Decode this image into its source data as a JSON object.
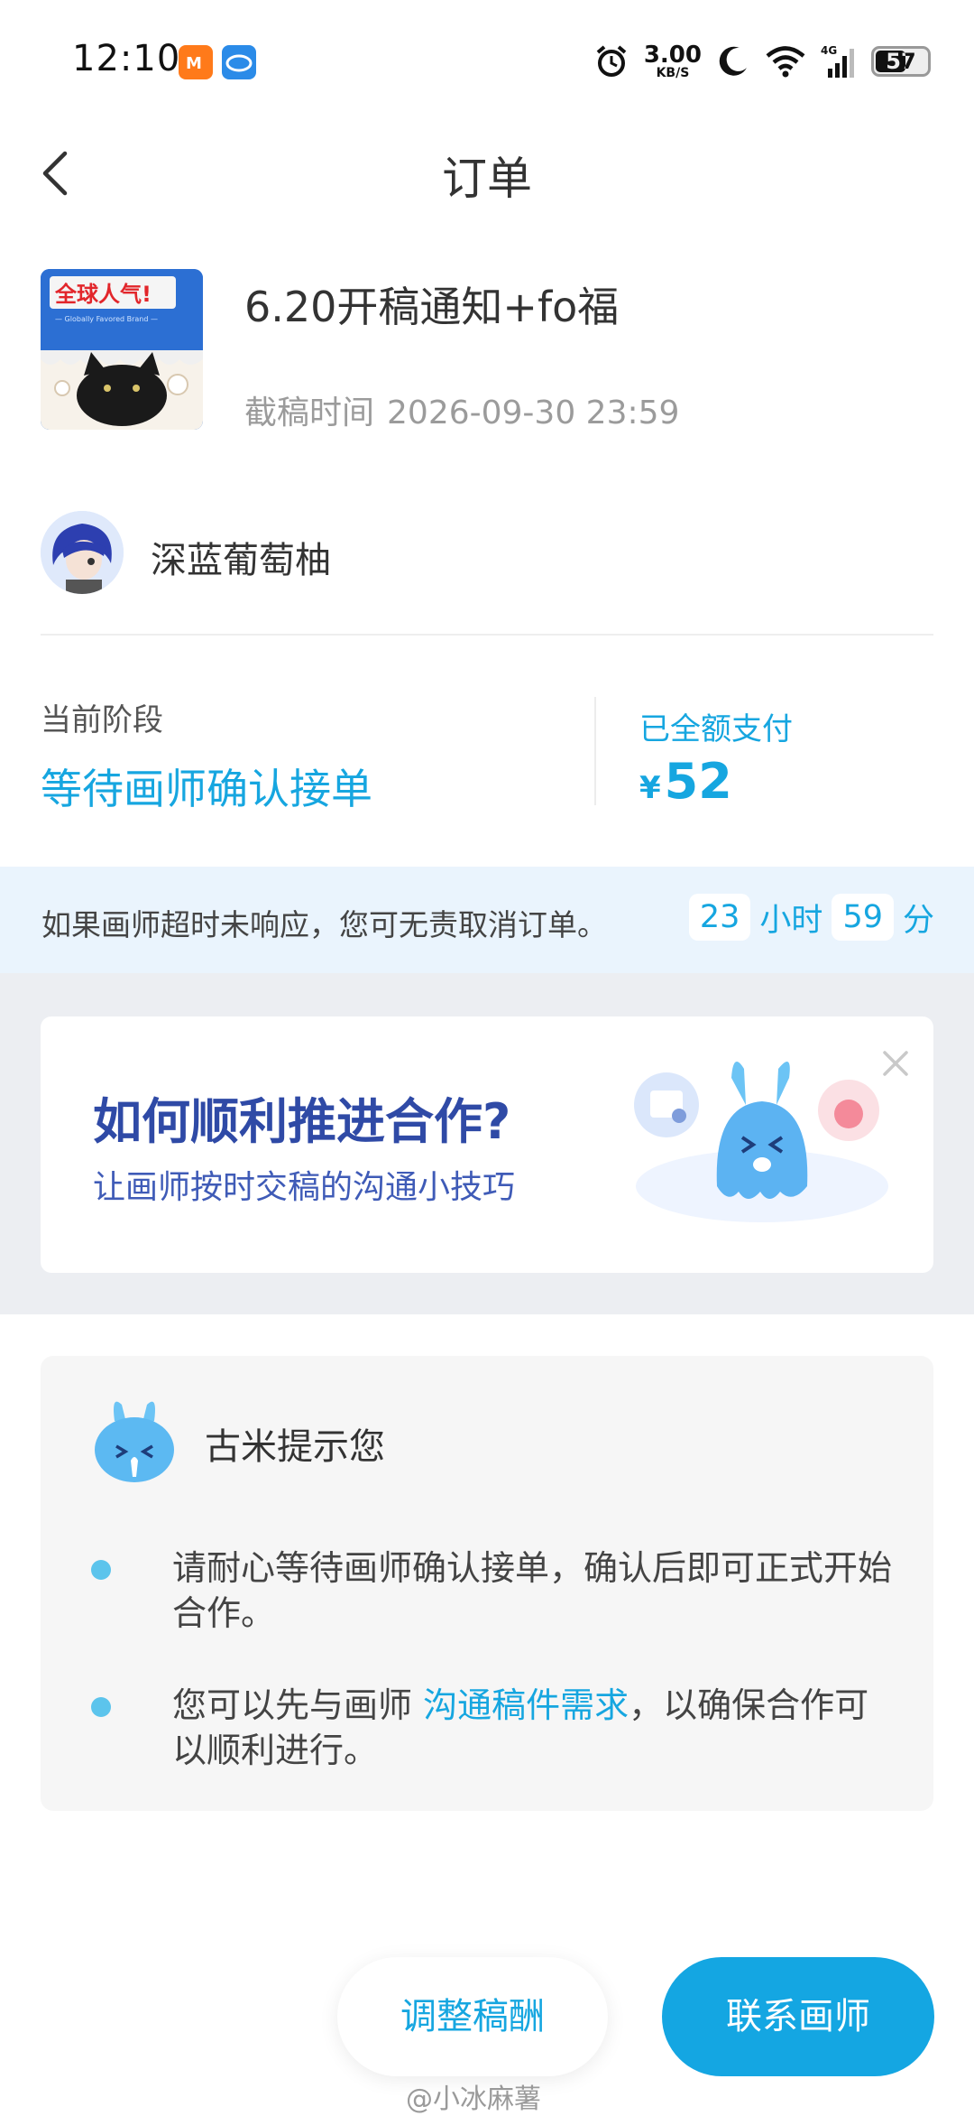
{
  "status_bar": {
    "time": "12:10",
    "net_speed_value": "3.00",
    "net_speed_unit": "KB/S",
    "network": "4G",
    "battery": "57",
    "icons": [
      "app-icon-orange",
      "app-icon-blue",
      "alarm-icon",
      "moon-icon",
      "wifi-icon",
      "signal-icon",
      "battery-icon"
    ]
  },
  "header": {
    "title": "订单",
    "back_icon": "chevron-left-icon"
  },
  "product": {
    "title": "6.20开稿通知+fo福",
    "deadline_label": "截稿时间",
    "deadline_value": "2026-09-30 23:59",
    "thumb_text": "全球人气!",
    "thumb_subtext": "— Globally Favored Brand —"
  },
  "artist": {
    "name": "深蓝葡萄柚"
  },
  "stage": {
    "label": "当前阶段",
    "value": "等待画师确认接单",
    "payment_label": "已全额支付",
    "currency": "¥",
    "amount": "52"
  },
  "timeout": {
    "text": "如果画师超时未响应，您可无责取消订单。",
    "hours": "23",
    "hours_unit": "小时",
    "minutes": "59",
    "minutes_unit": "分"
  },
  "banner": {
    "title": "如何顺利推进合作?",
    "subtitle": "让画师按时交稿的沟通小技巧",
    "close_icon": "close-icon"
  },
  "guide": {
    "title": "古米提示您",
    "item1": "请耐心等待画师确认接单，确认后即可正式开始合作。",
    "item2_prefix": "您可以先与画师 ",
    "item2_link": "沟通稿件需求",
    "item2_suffix": "，以确保合作可以顺利进行。"
  },
  "actions": {
    "adjust_label": "调整稿酬",
    "contact_label": "联系画师"
  },
  "watermark": "@小冰麻薯",
  "colors": {
    "accent": "#16a6e0",
    "banner_title": "#2f4aa6",
    "timeout_bg": "#eaf4fd",
    "section_bg": "#eceef2"
  }
}
